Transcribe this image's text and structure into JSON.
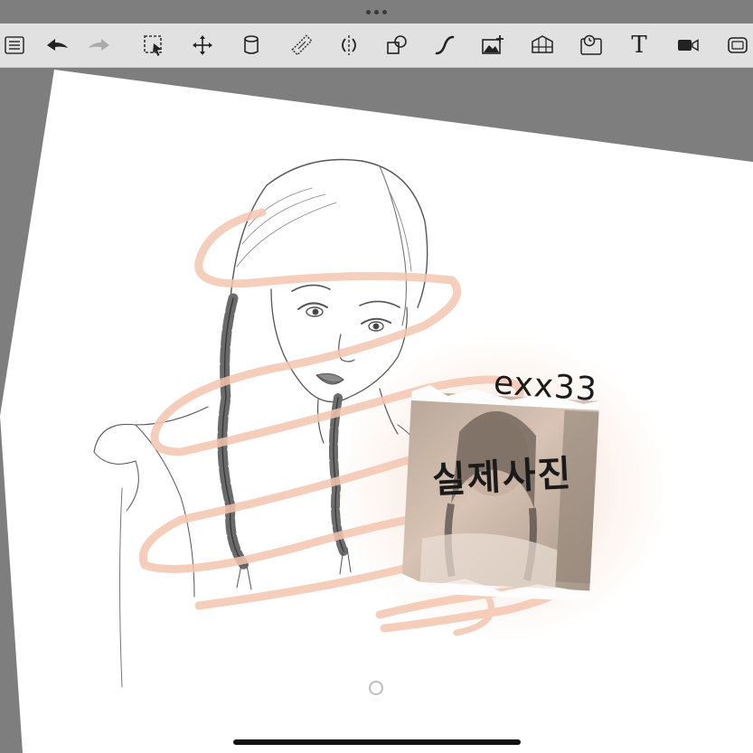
{
  "toolbar": {
    "items": [
      {
        "icon": "gallery-list-icon",
        "state": "enabled"
      },
      {
        "icon": "undo-icon",
        "state": "enabled"
      },
      {
        "icon": "redo-icon",
        "state": "disabled"
      },
      {
        "icon": "selection-icon",
        "state": "enabled"
      },
      {
        "icon": "transform-move-icon",
        "state": "enabled"
      },
      {
        "icon": "fill-bucket-icon",
        "state": "enabled"
      },
      {
        "icon": "ruler-icon",
        "state": "enabled"
      },
      {
        "icon": "symmetry-icon",
        "state": "enabled"
      },
      {
        "icon": "shapes-icon",
        "state": "enabled"
      },
      {
        "icon": "curve-icon",
        "state": "enabled"
      },
      {
        "icon": "import-image-icon",
        "state": "enabled"
      },
      {
        "icon": "perspective-guide-icon",
        "state": "enabled"
      },
      {
        "icon": "time-lapse-icon",
        "state": "enabled"
      },
      {
        "icon": "text-tool-icon",
        "state": "enabled"
      },
      {
        "icon": "video-record-icon",
        "state": "enabled"
      },
      {
        "icon": "fullscreen-icon",
        "state": "enabled"
      }
    ],
    "text_tool_glyph": "T"
  },
  "canvas": {
    "background_color": "#ffffff",
    "stroke_color": "#f4c6b0",
    "watermark_text": "exx33",
    "photo_label": "실제사진"
  }
}
